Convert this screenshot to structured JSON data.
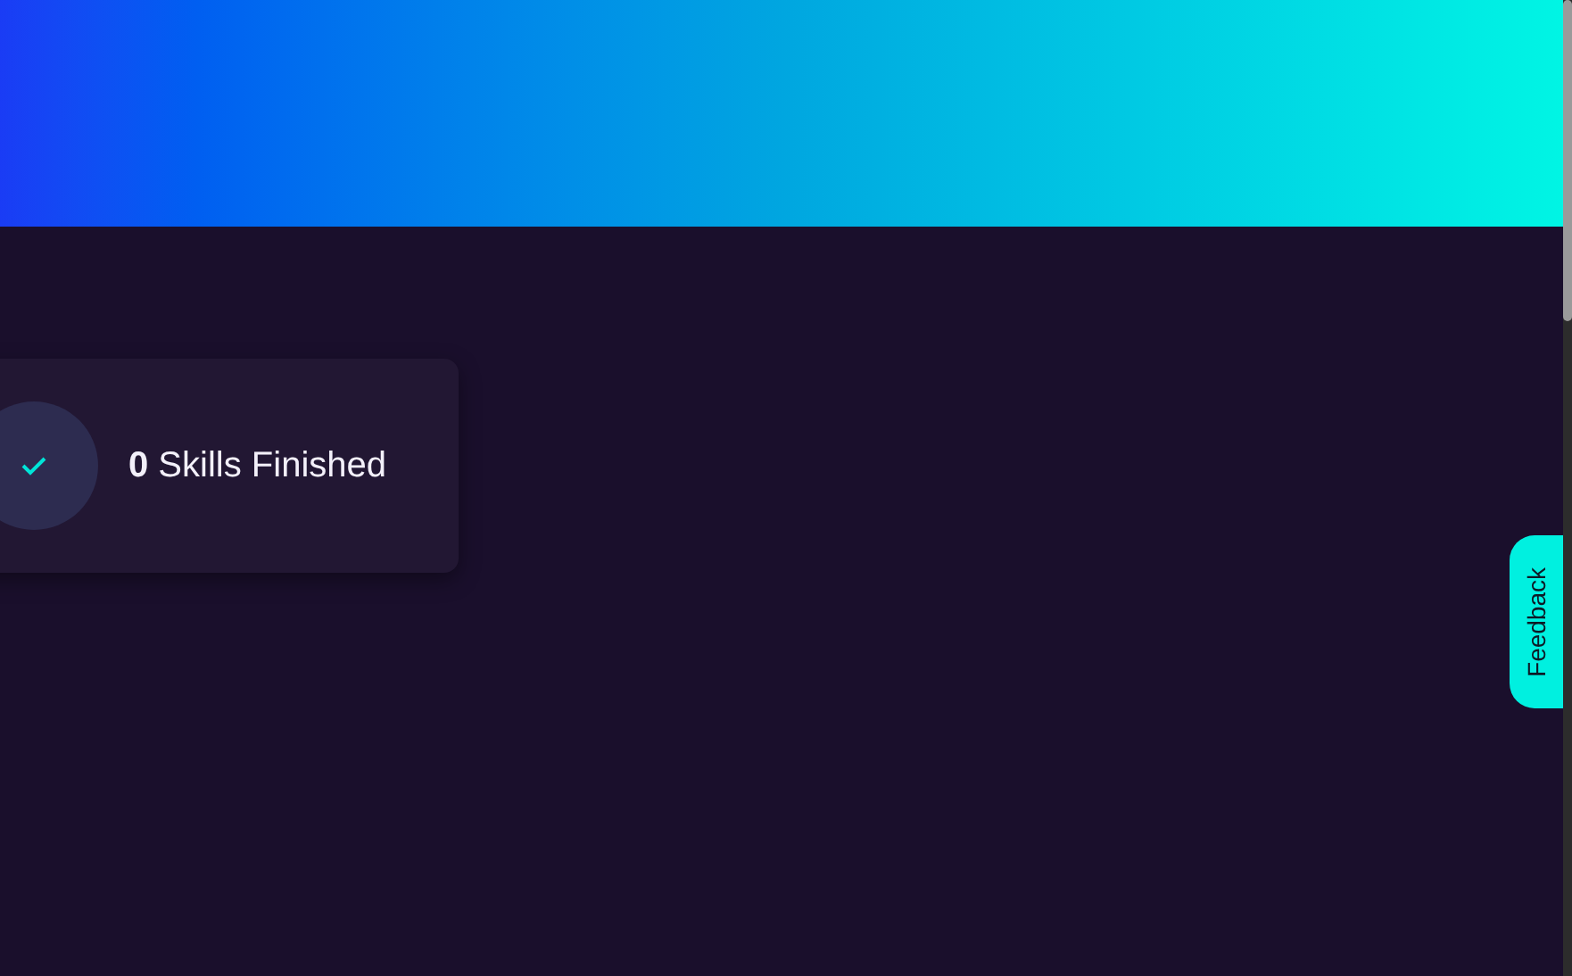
{
  "stat_card": {
    "text": "**0** Skills Finished"
  },
  "feedback_tab": {
    "label": "Feedback"
  }
}
